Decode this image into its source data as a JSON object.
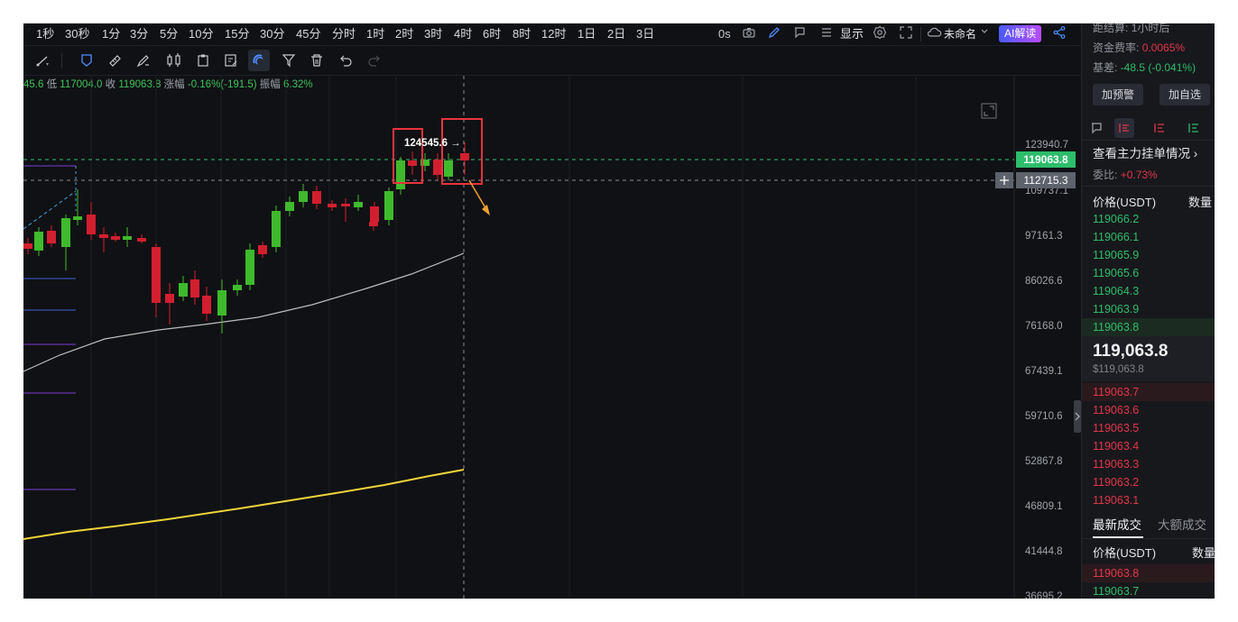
{
  "timeframes": [
    "1秒",
    "30秒",
    "1分",
    "3分",
    "5分",
    "10分",
    "15分",
    "30分",
    "45分",
    "分时",
    "1时",
    "2时",
    "3时",
    "4时",
    "6时",
    "8时",
    "12时",
    "1日",
    "2日",
    "3日"
  ],
  "toolbar_right": {
    "countdown": "0s",
    "display_label": "显示",
    "layout_name": "未命名",
    "ai_label": "AI解读"
  },
  "tools": [
    "line-tool-icon",
    "pin-icon",
    "ruler-icon",
    "brush-icon",
    "candles-icon",
    "clipboard-icon",
    "note-icon",
    "magnet-icon",
    "filter-icon",
    "trash-icon",
    "undo-icon",
    "redo-icon"
  ],
  "stats_line": {
    "high_tail": "45.6",
    "low_label": "低",
    "low": "117004.0",
    "close_label": "收",
    "close": "119063.8",
    "change_label": "涨幅",
    "change": "-0.16%(-191.5)",
    "amp_label": "振幅",
    "amp": "6.32%"
  },
  "chart": {
    "price_labels": [
      "123940.7",
      "109737.1",
      "97161.3",
      "86026.6",
      "76168.0",
      "67439.1",
      "59710.6",
      "52867.8",
      "46809.1",
      "41444.8",
      "36695.2"
    ],
    "current_price_tag": "119063.8",
    "crosshair_price_tag": "112715.3",
    "high_annotation": "124545.6 →",
    "colors": {
      "up": "#3fba2d",
      "down": "#d21f2f",
      "ma_white": "#bdbdbd",
      "ma_yellow": "#f0d43a",
      "annotation_box": "#e8343d",
      "arrow": "#f0a030"
    }
  },
  "right_panel": {
    "settle_label": "距结算:",
    "settle_value": "1小时后",
    "funding_label": "资金费率:",
    "funding_value": "0.0065%",
    "basis_label": "基差:",
    "basis_value": "-48.5 (-0.041%)",
    "add_alert": "加预警",
    "add_watch": "加自选",
    "depth_link": "查看主力挂单情况",
    "ratio_label": "委比:",
    "ratio_value": "+0.73%",
    "price_header": "价格(USDT)",
    "qty_header": "数量",
    "bids": [
      "119066.2",
      "119066.1",
      "119065.9",
      "119065.6",
      "119064.3",
      "119063.9",
      "119063.8"
    ],
    "last_price": "119,063.8",
    "last_price_usd": "$119,063.8",
    "asks": [
      "119063.7",
      "119063.6",
      "119063.5",
      "119063.4",
      "119063.3",
      "119063.2",
      "119063.1"
    ],
    "tab_latest": "最新成交",
    "tab_large": "大额成交",
    "trades_price_header": "价格(USDT)",
    "trades_qty_header": "数量",
    "trades": [
      "119063.8",
      "119063.7"
    ]
  }
}
